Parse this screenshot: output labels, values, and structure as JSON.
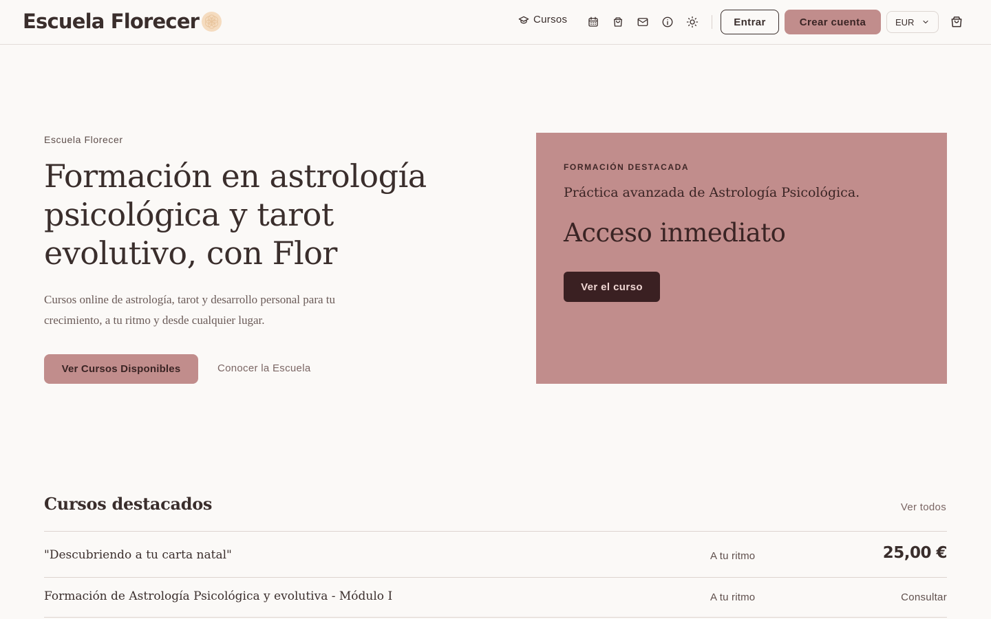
{
  "header": {
    "brand": "Escuela Florecer",
    "nav_courses": "Cursos",
    "icons": [
      "calendar-icon",
      "shopping-bag-icon",
      "mail-icon",
      "info-icon",
      "sun-icon"
    ],
    "login": "Entrar",
    "signup": "Crear cuenta",
    "currency": "EUR"
  },
  "hero": {
    "eyebrow": "Escuela Florecer",
    "title": "Formación en astrología psicológica y tarot evolutivo, con Flor",
    "subtitle": "Cursos online de astrología, tarot y desarrollo personal para tu crecimiento, a tu ritmo y desde cualquier lugar.",
    "primary_cta": "Ver Cursos Disponibles",
    "secondary_cta": "Conocer la Escuela"
  },
  "featured": {
    "eyebrow": "FORMACIÓN DESTACADA",
    "course": "Práctica avanzada de Astrología Psicológica.",
    "access": "Acceso inmediato",
    "cta": "Ver el curso"
  },
  "courses": {
    "title": "Cursos destacados",
    "see_all": "Ver todos",
    "items": [
      {
        "name": "\"Descubriendo a tu carta natal\"",
        "pace": "A tu ritmo",
        "price": "25,00 €"
      },
      {
        "name": "Formación de Astrología Psicológica y evolutiva - Módulo I",
        "pace": "A tu ritmo",
        "price": "Consultar"
      }
    ]
  },
  "colors": {
    "accent": "#c18d8c",
    "dark": "#3a2022",
    "background": "#fbf9f7",
    "text": "#3a2e2c"
  }
}
